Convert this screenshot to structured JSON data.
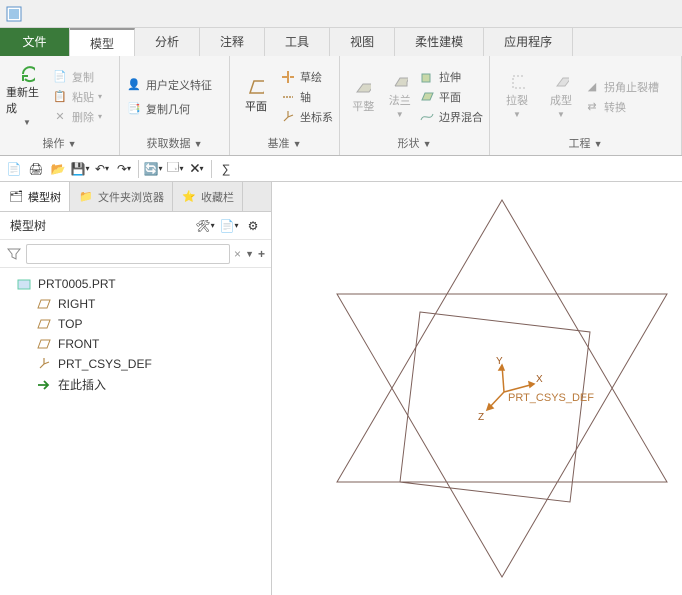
{
  "tabs": {
    "file": "文件",
    "items": [
      "模型",
      "分析",
      "注释",
      "工具",
      "视图",
      "柔性建模",
      "应用程序"
    ],
    "active": 0
  },
  "ribbon": {
    "regen": "重新生成",
    "copy": "复制",
    "paste": "粘贴",
    "delete": "删除",
    "group_ops": "操作",
    "user_feature": "用户定义特征",
    "copy_geom": "复制几何",
    "group_getdata": "获取数据",
    "plane": "平面",
    "sketch": "草绘",
    "axis": "轴",
    "csys": "坐标系",
    "group_datum": "基准",
    "pingzheng": "平整",
    "falan": "法兰",
    "extrude": "拉伸",
    "plane2": "平面",
    "boundary_blend": "边界混合",
    "group_shape": "形状",
    "lalie": "拉裂",
    "chengxing": "成型",
    "niaojiao": "拐角止裂槽",
    "zhuanhuan": "转换",
    "group_eng": "工程"
  },
  "side": {
    "tab_tree": "模型树",
    "tab_browser": "文件夹浏览器",
    "tab_fav": "收藏栏",
    "title": "模型树",
    "root": "PRT0005.PRT",
    "items": [
      {
        "label": "RIGHT",
        "kind": "plane"
      },
      {
        "label": "TOP",
        "kind": "plane"
      },
      {
        "label": "FRONT",
        "kind": "plane"
      },
      {
        "label": "PRT_CSYS_DEF",
        "kind": "csys"
      },
      {
        "label": "在此插入",
        "kind": "insert"
      }
    ],
    "filter_placeholder": ""
  },
  "viewport": {
    "csys_label": "PRT_CSYS_DEF",
    "axes": {
      "x": "X",
      "y": "Y",
      "z": "Z"
    }
  },
  "colors": {
    "accent": "#3a7a3a",
    "plane_stroke": "#8a6c67",
    "csys": "#c97b2a"
  }
}
